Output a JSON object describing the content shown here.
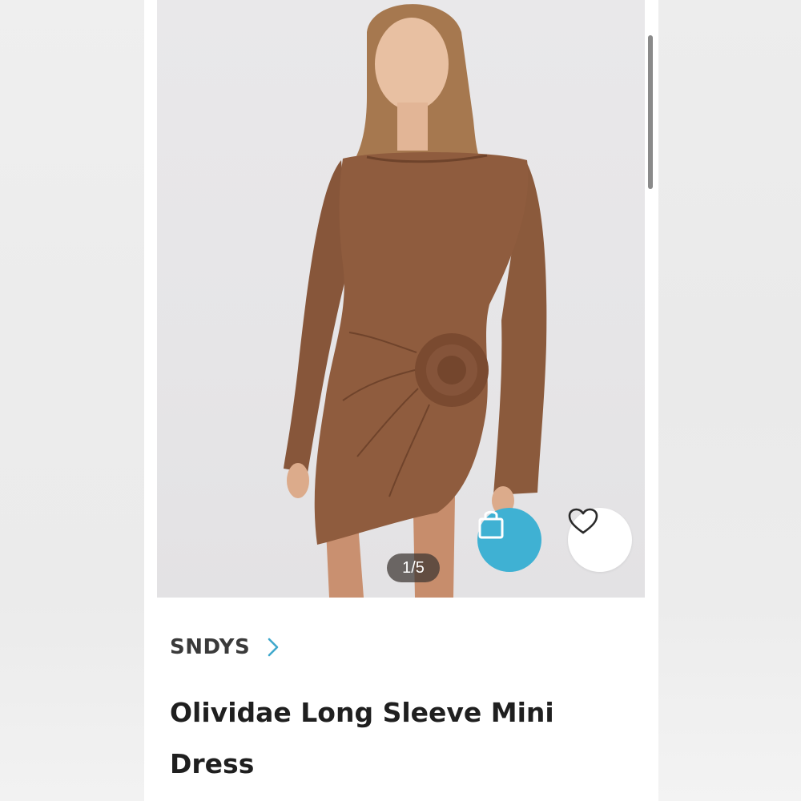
{
  "gallery": {
    "counter": "1/5",
    "image_subject": "model-wearing-brown-long-sleeve-mini-dress"
  },
  "actions": {
    "bag_icon": "shopping-bag-icon",
    "like_icon": "heart-icon",
    "accent_color": "#3fb1d3"
  },
  "product": {
    "brand": "SNDYS",
    "title": "Olividae Long Sleeve Mini Dress"
  },
  "colors": {
    "dress": "#8b5a3c",
    "text_primary": "#1f1f1f",
    "brand_text": "#3a3a3a"
  }
}
